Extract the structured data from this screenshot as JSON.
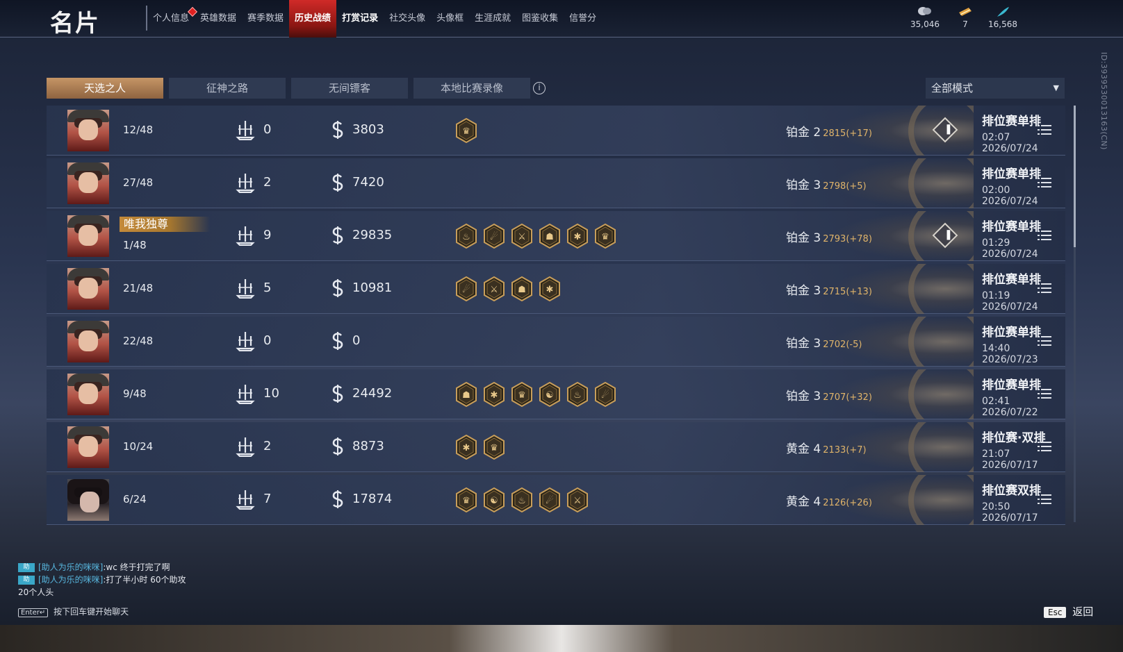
{
  "header": {
    "title": "名片",
    "nav": [
      {
        "label": "个人信息",
        "notify": true
      },
      {
        "label": "英雄数据"
      },
      {
        "label": "赛季数据"
      },
      {
        "label": "历史战绩",
        "active": true
      },
      {
        "label": "打赏记录",
        "bold": true
      },
      {
        "label": "社交头像"
      },
      {
        "label": "头像框"
      },
      {
        "label": "生涯成就"
      },
      {
        "label": "图鉴收集"
      },
      {
        "label": "信誉分"
      }
    ],
    "currency": [
      {
        "icon": "coin-stack-icon",
        "value": "35,046"
      },
      {
        "icon": "ticket-icon",
        "value": "7"
      },
      {
        "icon": "feather-icon",
        "value": "16,568"
      }
    ]
  },
  "subtabs": [
    "天选之人",
    "征神之路",
    "无间镖客",
    "本地比赛录像"
  ],
  "mode_select": {
    "value": "全部模式"
  },
  "side_id": "ID:3939530013163(CN)",
  "matches": [
    {
      "avatar": "a",
      "placement": "12/48",
      "kills": "0",
      "coins": "3803",
      "medals": 1,
      "rank": "铂金 2",
      "points": "2815(+17)",
      "up": true,
      "mode": "排位赛单排",
      "time": "02:07  2026/07/24"
    },
    {
      "avatar": "a",
      "placement": "27/48",
      "kills": "2",
      "coins": "7420",
      "medals": 0,
      "rank": "铂金 3",
      "points": "2798(+5)",
      "up": false,
      "mode": "排位赛单排",
      "time": "02:00  2026/07/24"
    },
    {
      "avatar": "a",
      "placement": "1/48",
      "title": "唯我独尊",
      "kills": "9",
      "coins": "29835",
      "medals": 6,
      "rank": "铂金 3",
      "points": "2793(+78)",
      "up": true,
      "mode": "排位赛单排",
      "time": "01:29  2026/07/24"
    },
    {
      "avatar": "a",
      "placement": "21/48",
      "kills": "5",
      "coins": "10981",
      "medals": 4,
      "rank": "铂金 3",
      "points": "2715(+13)",
      "up": false,
      "mode": "排位赛单排",
      "time": "01:19  2026/07/24"
    },
    {
      "avatar": "a",
      "placement": "22/48",
      "kills": "0",
      "coins": "0",
      "medals": 0,
      "rank": "铂金 3",
      "points": "2702(-5)",
      "up": false,
      "mode": "排位赛单排",
      "time": "14:40  2026/07/23"
    },
    {
      "avatar": "a",
      "placement": "9/48",
      "kills": "10",
      "coins": "24492",
      "medals": 6,
      "rank": "铂金 3",
      "points": "2707(+32)",
      "up": false,
      "mode": "排位赛单排",
      "time": "02:41  2026/07/22"
    },
    {
      "avatar": "a",
      "placement": "10/24",
      "kills": "2",
      "coins": "8873",
      "medals": 2,
      "rank": "黄金 4",
      "points": "2133(+7)",
      "up": false,
      "mode": "排位赛·双排",
      "time": "21:07  2026/07/17"
    },
    {
      "avatar": "b",
      "placement": "6/24",
      "kills": "7",
      "coins": "17874",
      "medals": 5,
      "rank": "黄金 4",
      "points": "2126(+26)",
      "up": false,
      "mode": "排位赛双排",
      "time": "20:50  2026/07/17"
    }
  ],
  "chat": {
    "lines": [
      {
        "tag": "助",
        "name": "[助人为乐的咪咪]",
        "text": ":wc  终于打完了啊"
      },
      {
        "tag": "助",
        "name": "[助人为乐的咪咪]",
        "text": ":打了半小时 60个助攻"
      },
      {
        "tag": "",
        "name": "",
        "text": "20个人头"
      }
    ],
    "hint_key": "Enter↵",
    "hint": "按下回车键开始聊天"
  },
  "esc": {
    "key": "Esc",
    "label": "返回"
  },
  "colors": {
    "accent_red": "#d02a28",
    "active_tab": "#c59566",
    "points_gold": "#e0b46a"
  }
}
